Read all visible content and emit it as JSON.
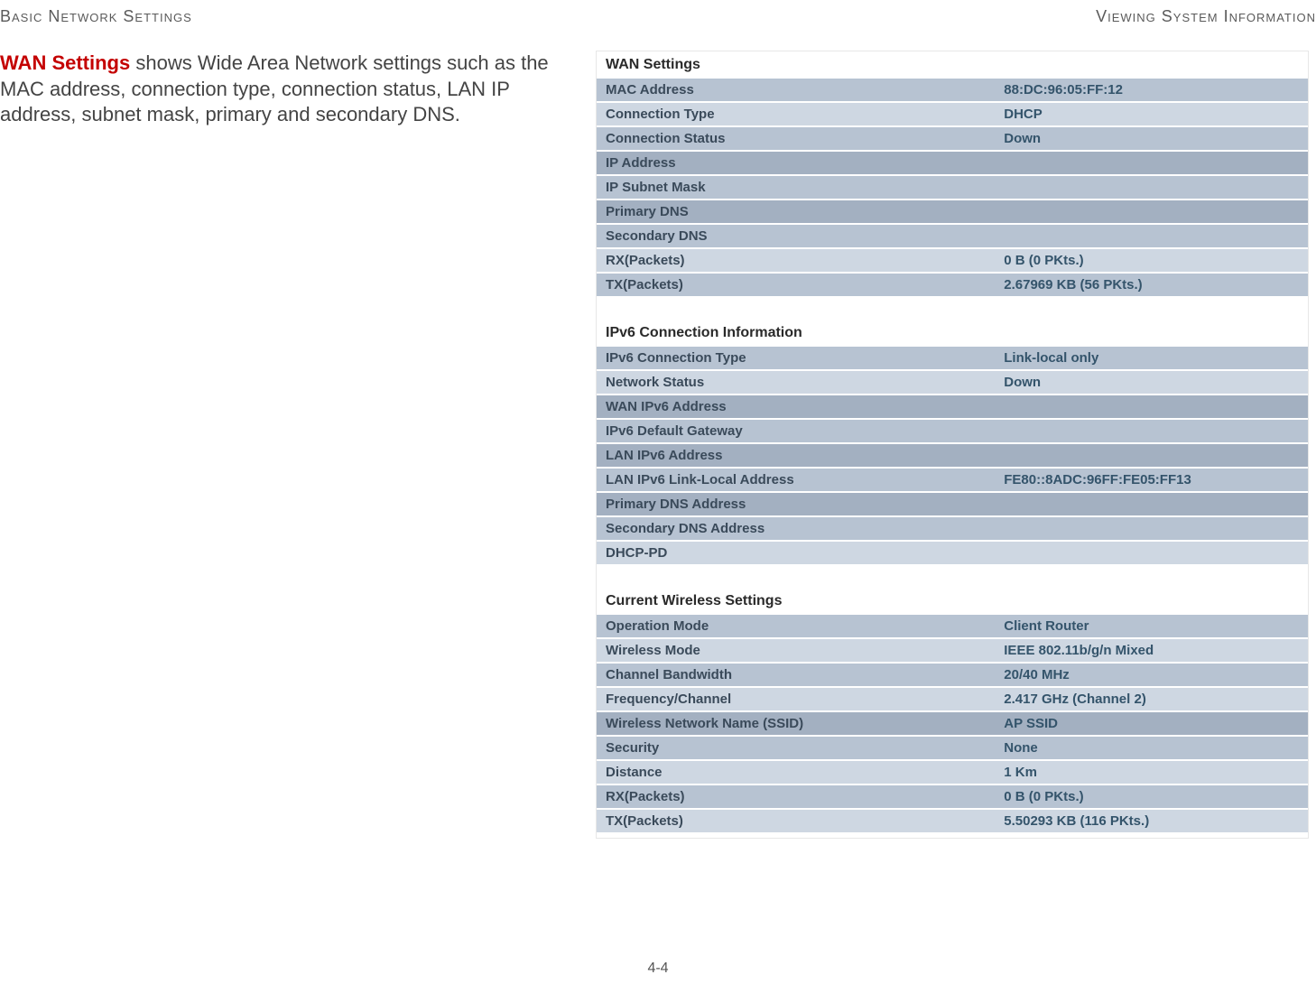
{
  "header": {
    "left": "Basic Network Settings",
    "right": "Viewing System Information"
  },
  "description": {
    "title": "WAN Settings",
    "body": " shows Wide Area Network settings such as the MAC address, connection type, connection status, LAN IP address, subnet mask, primary and secondary DNS."
  },
  "sections": {
    "wan": {
      "title": "WAN Settings",
      "rows": {
        "mac_address": {
          "label": "MAC Address",
          "value": "88:DC:96:05:FF:12"
        },
        "connection_type": {
          "label": "Connection Type",
          "value": "DHCP"
        },
        "connection_status": {
          "label": "Connection Status",
          "value": "Down"
        },
        "ip_address": {
          "label": "IP Address",
          "value": ""
        },
        "ip_subnet_mask": {
          "label": "IP Subnet Mask",
          "value": ""
        },
        "primary_dns": {
          "label": "Primary DNS",
          "value": ""
        },
        "secondary_dns": {
          "label": "Secondary DNS",
          "value": ""
        },
        "rx": {
          "label": "RX(Packets)",
          "value": "0 B (0 PKts.)"
        },
        "tx": {
          "label": "TX(Packets)",
          "value": "2.67969 KB (56 PKts.)"
        }
      }
    },
    "ipv6": {
      "title": "IPv6 Connection Information",
      "rows": {
        "conn_type": {
          "label": "IPv6 Connection Type",
          "value": "Link-local only"
        },
        "net_status": {
          "label": "Network Status",
          "value": "Down"
        },
        "wan_addr": {
          "label": "WAN IPv6 Address",
          "value": ""
        },
        "gateway": {
          "label": "IPv6 Default Gateway",
          "value": ""
        },
        "lan_addr": {
          "label": "LAN IPv6 Address",
          "value": ""
        },
        "link_local": {
          "label": "LAN IPv6 Link-Local Address",
          "value": "FE80::8ADC:96FF:FE05:FF13"
        },
        "primary_dns": {
          "label": "Primary DNS Address",
          "value": ""
        },
        "secondary_dns": {
          "label": "Secondary DNS Address",
          "value": ""
        },
        "dhcp_pd": {
          "label": "DHCP-PD",
          "value": ""
        }
      }
    },
    "wireless": {
      "title": "Current Wireless Settings",
      "rows": {
        "op_mode": {
          "label": "Operation Mode",
          "value": "Client Router"
        },
        "wmode": {
          "label": "Wireless Mode",
          "value": "IEEE 802.11b/g/n Mixed"
        },
        "bw": {
          "label": "Channel Bandwidth",
          "value": "20/40 MHz"
        },
        "freq": {
          "label": "Frequency/Channel",
          "value": "2.417 GHz (Channel 2)"
        },
        "ssid": {
          "label": "Wireless Network Name (SSID)",
          "value": "AP SSID"
        },
        "security": {
          "label": "Security",
          "value": "None"
        },
        "distance": {
          "label": "Distance",
          "value": "1 Km"
        },
        "rx": {
          "label": "RX(Packets)",
          "value": "0 B (0 PKts.)"
        },
        "tx": {
          "label": "TX(Packets)",
          "value": "5.50293 KB (116 PKts.)"
        }
      }
    }
  },
  "page_number": "4-4"
}
